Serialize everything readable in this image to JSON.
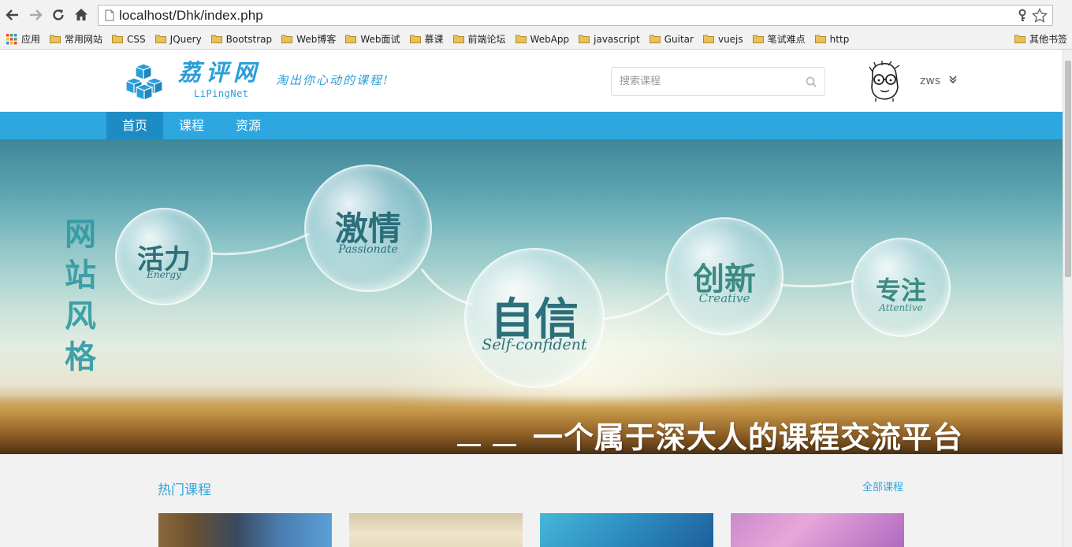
{
  "browser": {
    "url": "localhost/Dhk/index.php",
    "bookmarks": [
      "常用网站",
      "CSS",
      "JQuery",
      "Bootstrap",
      "Web博客",
      "Web面试",
      "慕课",
      "前端论坛",
      "WebApp",
      "javascript",
      "Guitar",
      "vuejs",
      "笔试难点",
      "http"
    ],
    "apps_label": "应用",
    "other_bookmarks_label": "其他书签",
    "folder_color": "#e8c15a"
  },
  "site": {
    "logo_cn": "荔评网",
    "logo_en": "LiPingNet",
    "slogan": "淘出你心动的课程!",
    "search_placeholder": "搜索课程",
    "username": "zws",
    "accent_color": "#2ea7e0"
  },
  "nav": {
    "items": [
      {
        "label": "首页",
        "active": true
      },
      {
        "label": "课程",
        "active": false
      },
      {
        "label": "资源",
        "active": false
      }
    ]
  },
  "banner": {
    "style_word": "网站风格",
    "bubbles": [
      {
        "cn": "活力",
        "en": "Energy"
      },
      {
        "cn": "激情",
        "en": "Passionate"
      },
      {
        "cn": "自信",
        "en": "Self-confident"
      },
      {
        "cn": "创新",
        "en": "Creative"
      },
      {
        "cn": "专注",
        "en": "Attentive"
      }
    ],
    "caption": "一个属于深大人的课程交流平台"
  },
  "content": {
    "section_title": "热门课程",
    "all_link": "全部课程"
  }
}
